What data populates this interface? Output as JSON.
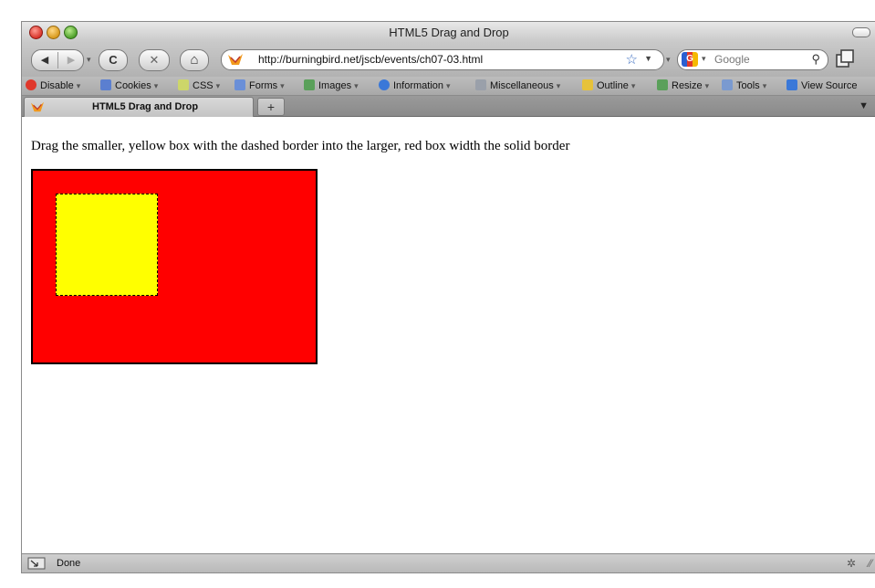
{
  "window": {
    "title": "HTML5 Drag and Drop"
  },
  "nav": {
    "back_icon": "back-arrow-icon",
    "forward_icon": "forward-arrow-icon",
    "reload_glyph": "C",
    "stop_glyph": "✕",
    "home_glyph": "⌂",
    "url": "http://burningbird.net/jscb/events/ch07-03.html",
    "search_placeholder": "Google"
  },
  "bookmarks": [
    {
      "label": "Disable",
      "icon": "disable-icon",
      "color": "#e0382b"
    },
    {
      "label": "Cookies",
      "icon": "cookies-icon",
      "color": "#5b7fd0"
    },
    {
      "label": "CSS",
      "icon": "css-icon",
      "color": "#cdd66a"
    },
    {
      "label": "Forms",
      "icon": "forms-icon",
      "color": "#6a8fd8"
    },
    {
      "label": "Images",
      "icon": "images-icon",
      "color": "#5aa05a"
    },
    {
      "label": "Information",
      "icon": "information-icon",
      "color": "#3a78d8"
    },
    {
      "label": "Miscellaneous",
      "icon": "miscellaneous-icon",
      "color": "#9aa0aa"
    },
    {
      "label": "Outline",
      "icon": "outline-icon",
      "color": "#e6c23a"
    },
    {
      "label": "Resize",
      "icon": "resize-icon",
      "color": "#5aa05a"
    },
    {
      "label": "Tools",
      "icon": "tools-icon",
      "color": "#7a9ad0"
    },
    {
      "label": "View Source",
      "icon": "view-source-icon",
      "color": "#3a78d8"
    }
  ],
  "tab": {
    "title": "HTML5 Drag and Drop",
    "new_tab_glyph": "+"
  },
  "page": {
    "instruction": "Drag the smaller, yellow box with the dashed border into the larger, red box width the solid border",
    "drop_box_color": "#ff0000",
    "drag_box_color": "#ffff00"
  },
  "status": {
    "text": "Done"
  }
}
